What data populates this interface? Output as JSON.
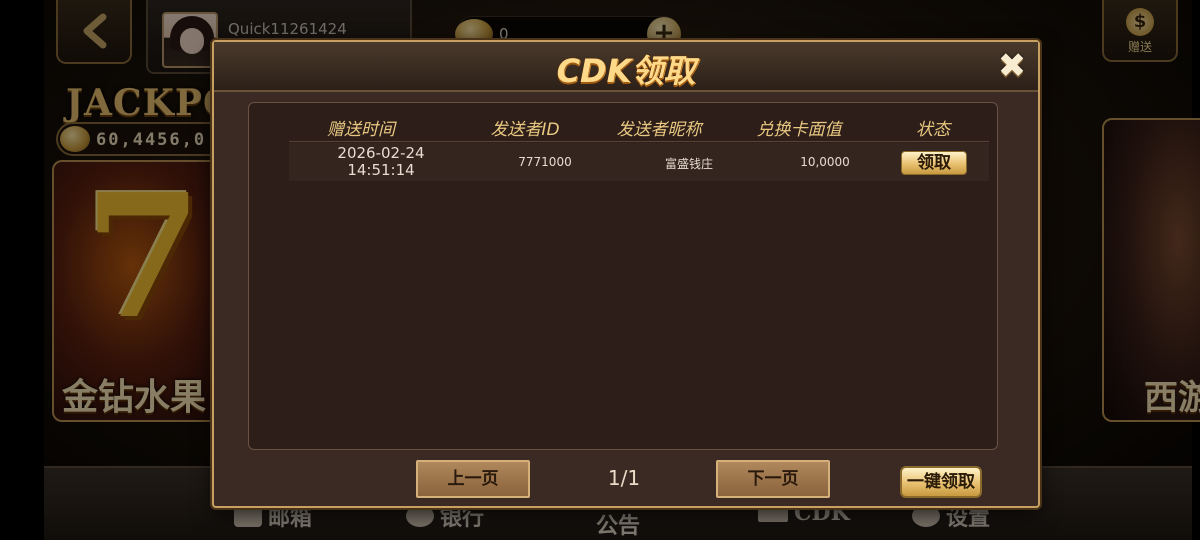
{
  "lobby": {
    "username": "Quick11261424",
    "coin_balance": "0",
    "gift_label": "赠送",
    "jackpot_title": "JACKPO",
    "jackpot_value": "60,4456,0",
    "game_left_name": "金钻水果",
    "game_right_name": "西游",
    "bottom_nav": [
      "邮箱",
      "银行",
      "公告",
      "CDK",
      "设置"
    ]
  },
  "dialog": {
    "title": "CDK领取",
    "columns": [
      "赠送时间",
      "发送者ID",
      "发送者昵称",
      "兑换卡面值",
      "状态"
    ],
    "rows": [
      {
        "date": "2026-02-24",
        "time": "14:51:14",
        "sender_id": "7771000",
        "sender_name": "富盛钱庄",
        "card_value": "10,0000",
        "action": "领取"
      }
    ],
    "prev_label": "上一页",
    "next_label": "下一页",
    "page_info": "1/1",
    "claim_all_label": "一键领取"
  }
}
